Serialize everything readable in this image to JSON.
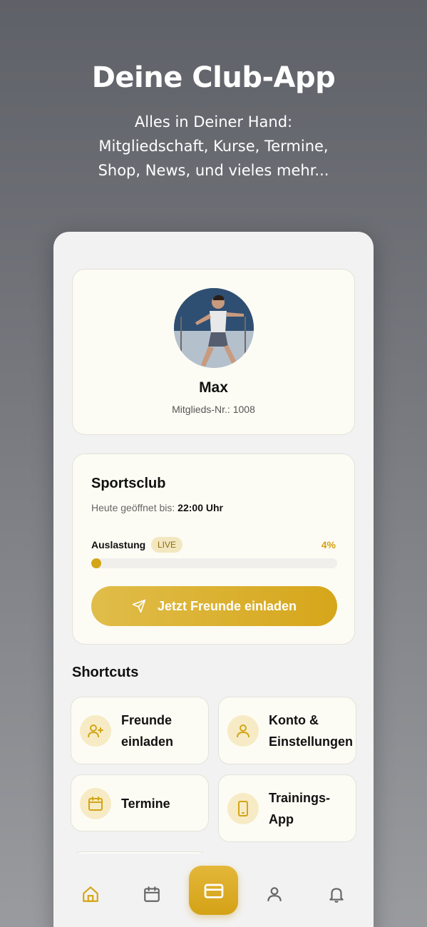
{
  "hero": {
    "title": "Deine Club-App",
    "subtitle_lines": [
      "Alles in Deiner Hand:",
      "Mitgliedschaft, Kurse, Termine,",
      "Shop, News, und vieles mehr..."
    ]
  },
  "profile": {
    "name": "Max",
    "member_id": "Mitglieds-Nr.: 1008"
  },
  "club": {
    "name": "Sportsclub",
    "open_label": "Heute geöffnet bis:",
    "open_until": "22:00 Uhr",
    "load_label": "Auslastung",
    "live_badge": "LIVE",
    "load_percent_text": "4%",
    "load_fraction": 0.04,
    "invite_button": "Jetzt Freunde einladen"
  },
  "shortcuts": {
    "title": "Shortcuts",
    "items": [
      {
        "line1": "Freunde",
        "line2": "einladen",
        "icon": "user-plus-icon"
      },
      {
        "line1": "Konto &",
        "line2": "Einstellungen",
        "icon": "user-icon"
      },
      {
        "line1": "Termine",
        "line2": "",
        "icon": "calendar-icon"
      },
      {
        "line1": "Trainings-",
        "line2": "App",
        "icon": "phone-icon"
      }
    ]
  },
  "nav": {
    "items": [
      "home-icon",
      "calendar-icon",
      "card-icon",
      "user-icon",
      "bell-icon"
    ]
  },
  "colors": {
    "accent": "#d4a516",
    "card_bg": "#fdfcf4",
    "icon_bg": "#f6ebc5"
  }
}
